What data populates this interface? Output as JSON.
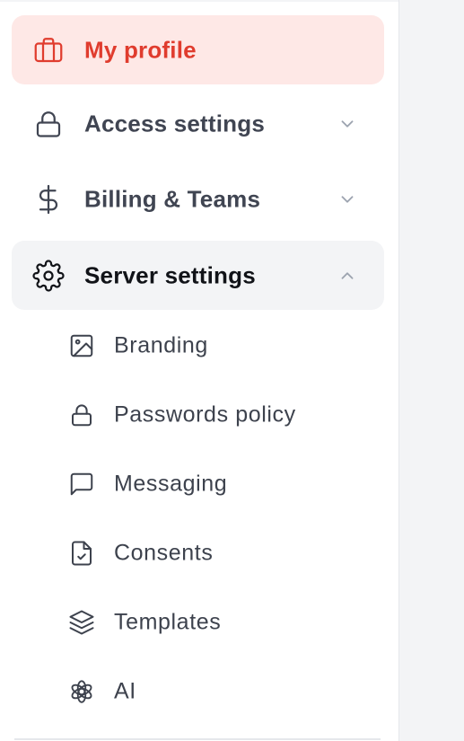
{
  "sidebar": {
    "items": [
      {
        "label": "My profile",
        "icon": "briefcase-icon",
        "state": "active"
      },
      {
        "label": "Access settings",
        "icon": "lock-icon",
        "chevron": "chevron-down-icon"
      },
      {
        "label": "Billing & Teams",
        "icon": "dollar-icon",
        "chevron": "chevron-down-icon"
      },
      {
        "label": "Server settings",
        "icon": "gear-icon",
        "chevron": "chevron-up-icon",
        "state": "expanded"
      }
    ],
    "subitems": [
      {
        "label": "Branding",
        "icon": "image-icon"
      },
      {
        "label": "Passwords policy",
        "icon": "lock-icon"
      },
      {
        "label": "Messaging",
        "icon": "message-square-icon"
      },
      {
        "label": "Consents",
        "icon": "file-check-icon"
      },
      {
        "label": "Templates",
        "icon": "layers-icon"
      },
      {
        "label": "AI",
        "icon": "openai-logo-icon"
      }
    ]
  },
  "colors": {
    "accent": "#e03c2e",
    "active_bg": "#fee8e6",
    "expanded_bg": "#f3f4f6",
    "text": "#404552"
  }
}
